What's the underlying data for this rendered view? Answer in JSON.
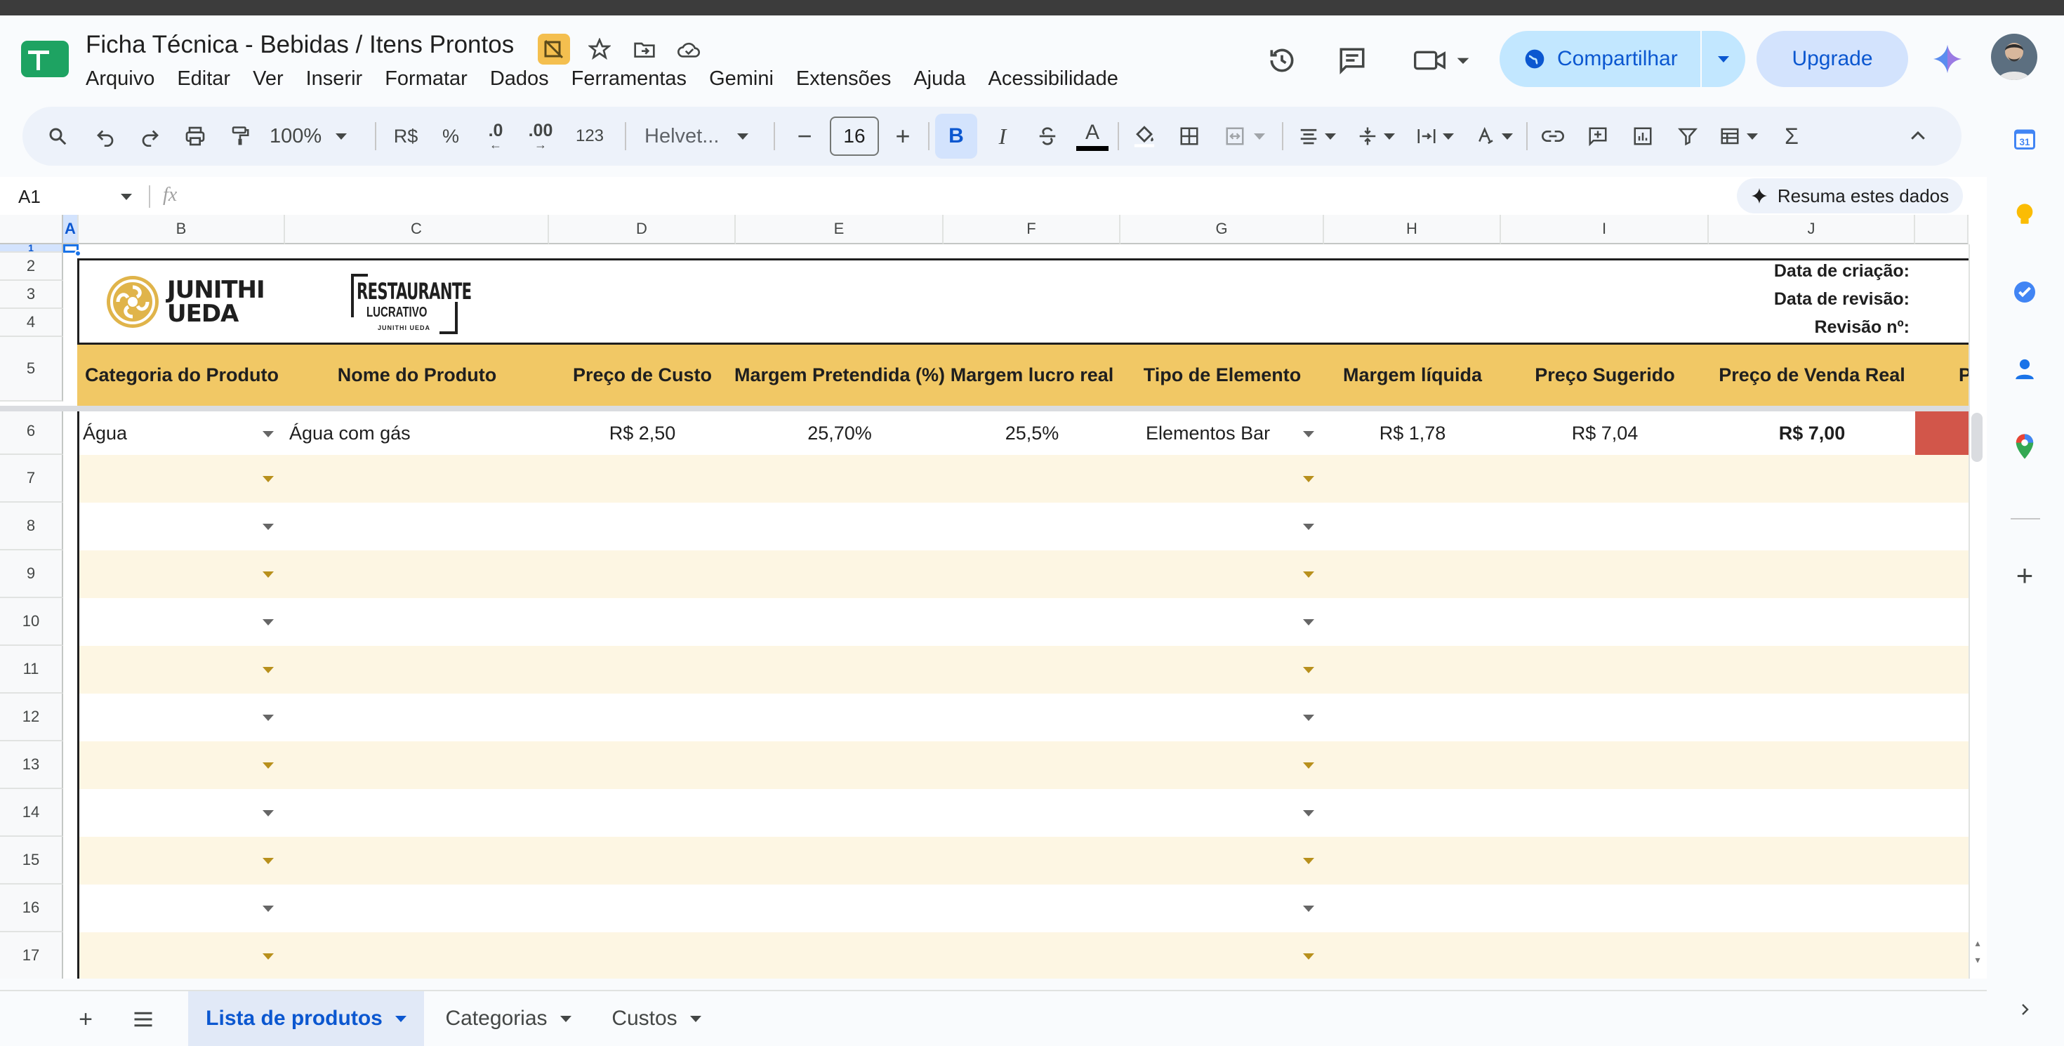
{
  "app": {
    "title": "Ficha Técnica - Bebidas / Itens Prontos",
    "menu": [
      "Arquivo",
      "Editar",
      "Ver",
      "Inserir",
      "Formatar",
      "Dados",
      "Ferramentas",
      "Gemini",
      "Extensões",
      "Ajuda",
      "Acessibilidade"
    ],
    "share_label": "Compartilhar",
    "upgrade_label": "Upgrade"
  },
  "toolbar": {
    "zoom": "100%",
    "currency": "R$",
    "percent": "%",
    "dec_minus": ".0",
    "dec_plus": ".00",
    "number_format": "123",
    "font": "Helvet...",
    "font_size": "16",
    "bold": "B",
    "italic": "I",
    "text_color_label": "A",
    "sum_label": "Σ"
  },
  "formula_bar": {
    "cell_ref": "A1",
    "fx": "fx",
    "summarize_label": "Resuma estes dados"
  },
  "columns": [
    "A",
    "B",
    "C",
    "D",
    "E",
    "F",
    "G",
    "H",
    "I",
    "J"
  ],
  "rows": [
    "1",
    "2",
    "3",
    "4",
    "5",
    "6",
    "7",
    "8",
    "9",
    "10",
    "11",
    "12",
    "13",
    "14",
    "15",
    "16",
    "17"
  ],
  "logos": {
    "junithi_line1": "JUNITHI",
    "junithi_line2": "UEDA",
    "restaurante": "RESTAURANTE",
    "lucrativo": "LUCRATIVO",
    "restaurante_small": "JUNITHI UEDA"
  },
  "meta_labels": [
    "Data de criação:",
    "Data de revisão:",
    "Revisão nº:"
  ],
  "table": {
    "headers": [
      "Categoria do Produto",
      "Nome do Produto",
      "Preço de Custo",
      "Margem Pretendida (%)",
      "Margem lucro real",
      "Tipo de Elemento",
      "Margem líquida",
      "Preço Sugerido",
      "Preço de Venda Real",
      "P"
    ],
    "row": [
      "Água",
      "Água com gás",
      "R$ 2,50",
      "25,70%",
      "25,5%",
      "Elementos Bar",
      "R$ 1,78",
      "R$ 7,04",
      "R$ 7,00"
    ]
  },
  "colors": {
    "header_band": "#f1c865",
    "stripe": "#fdf6e3",
    "alert": "#d2564a",
    "accent": "#0b57d0",
    "share_bg": "#c2e7ff"
  },
  "sheet_tabs": [
    "Lista de produtos",
    "Categorias",
    "Custos"
  ]
}
